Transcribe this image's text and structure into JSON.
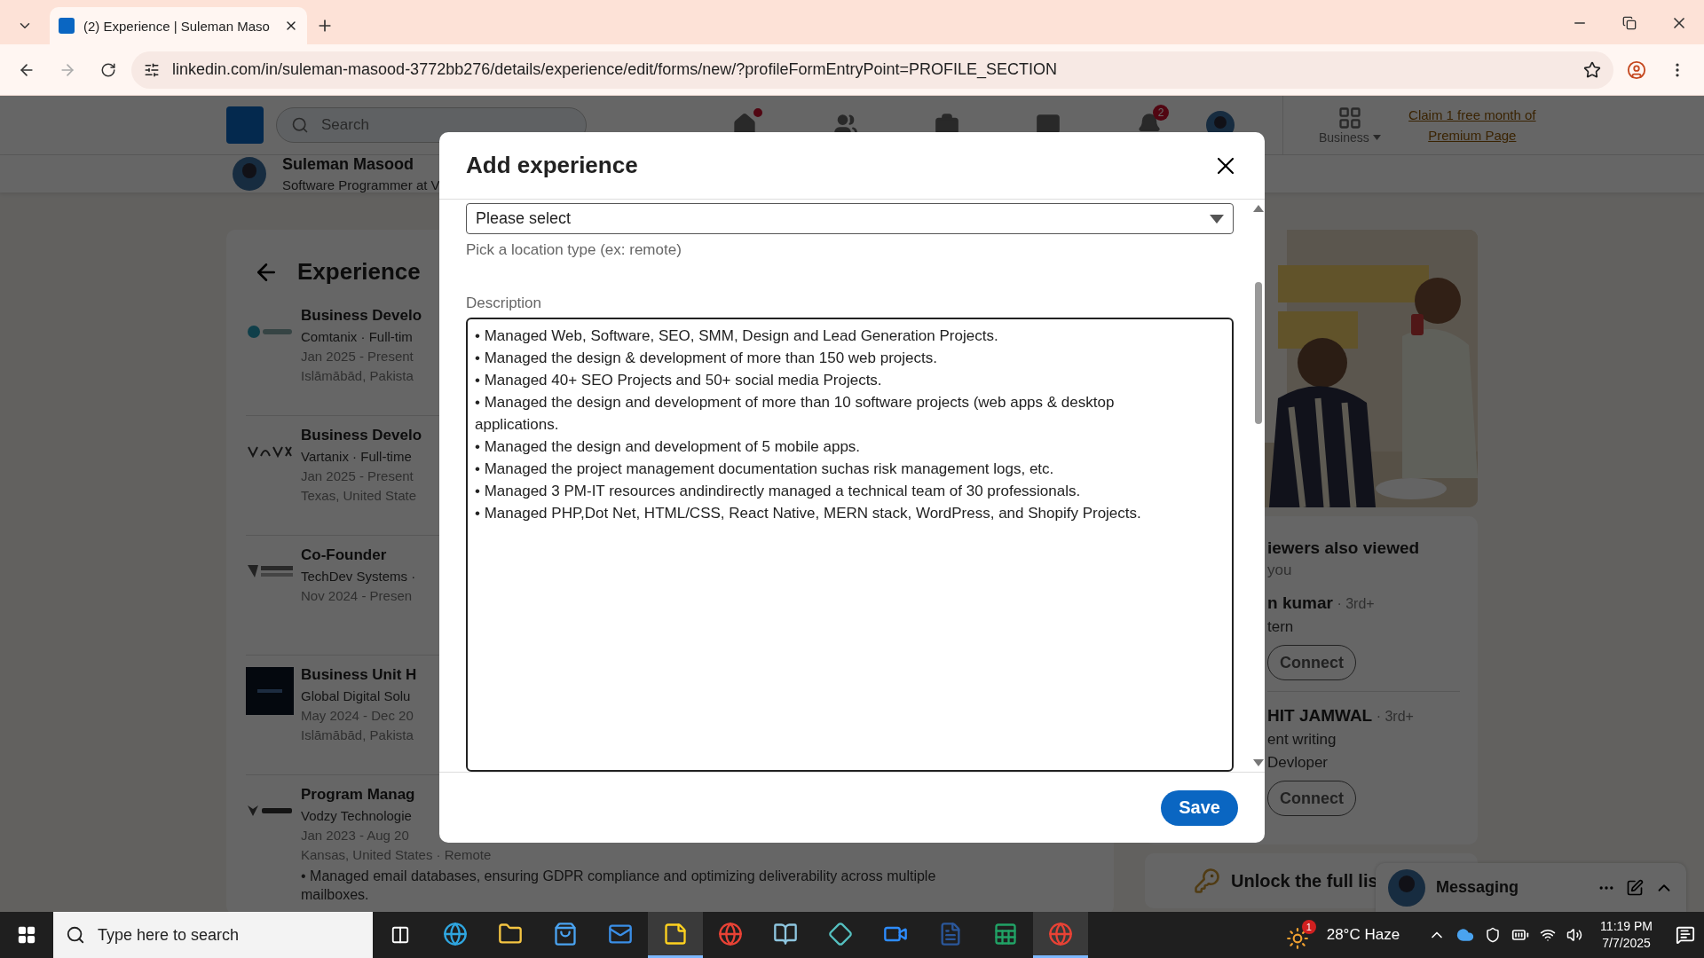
{
  "browser": {
    "tabs": [
      {
        "title": "(2) Experience | Suleman Maso",
        "selected": true
      }
    ],
    "url": "linkedin.com/in/suleman-masood-3772bb276/details/experience/edit/forms/new/?profileFormEntryPoint=PROFILE_SECTION"
  },
  "header": {
    "search_placeholder": "Search",
    "nav": [
      {
        "dot": true
      },
      {
        "dot": false
      },
      {
        "dot": false
      },
      {
        "dot": false
      },
      {
        "badge": "2"
      }
    ],
    "business": "Business",
    "premium": "Claim 1 free month of Premium Page"
  },
  "profile": {
    "name": "Suleman Masood",
    "headline": "Software Programmer at V"
  },
  "experience": {
    "title": "Experience",
    "entries": [
      {
        "kind": "ring",
        "title": "Business Develo",
        "lines": [
          "Comtanix · Full-tim",
          "Jan 2025 - Present",
          "Islāmābād, Pakista"
        ]
      },
      {
        "kind": "wordmark",
        "title": "Business Develo",
        "lines": [
          "Vartanix · Full-time",
          "Jan 2025 - Present",
          "Texas, United State"
        ]
      },
      {
        "kind": "stripes",
        "title": "Co-Founder",
        "lines": [
          "TechDev Systems ·",
          "Nov 2024 - Presen"
        ]
      },
      {
        "kind": "dark",
        "title": "Business Unit H",
        "lines": [
          "Global Digital Solu",
          "May 2024 - Dec 20",
          "Islāmābād, Pakista"
        ]
      },
      {
        "kind": "wing",
        "title": "Program Manag",
        "lines": [
          "Vodzy Technologie",
          "Jan 2023 - Aug 20",
          "Kansas, United States · Remote"
        ]
      }
    ],
    "note": "• Managed email databases, ensuring GDPR compliance and optimizing deliverability across multiple mailboxes."
  },
  "sidebar": {
    "title": "iewers also viewed",
    "subtitle": "you",
    "people": [
      {
        "name": "n kumar",
        "degree": "· 3rd+",
        "lines": [
          "tern"
        ],
        "action": "Connect"
      },
      {
        "name": "HIT JAMWAL",
        "degree": "· 3rd+",
        "lines": [
          "ent writing",
          "Devloper"
        ],
        "action": "Connect"
      }
    ],
    "unlock": "Unlock the full lis"
  },
  "messaging": {
    "title": "Messaging"
  },
  "modal": {
    "title": "Add experience",
    "select": {
      "value": "Please select",
      "hint": "Pick a location type (ex: remote)"
    },
    "description": {
      "label": "Description",
      "lines": [
        "• Managed Web, Software, SEO, SMM, Design and Lead Generation Projects.",
        "• Managed the design & development of more than 150 web projects.",
        "• Managed 40+ SEO Projects and 50+ social media Projects.",
        "• Managed the design and development of more than 10 software projects (web apps & desktop",
        "applications.",
        "• Managed the design and development of 5 mobile apps.",
        "• Managed the project management documentation suchas risk management logs, etc.",
        "• Managed 3 PM-IT resources andindirectly managed a technical team of 30 professionals.",
        "• Managed PHP,Dot Net, HTML/CSS, React Native, MERN stack, WordPress, and Shopify Projects."
      ]
    },
    "save": "Save"
  },
  "taskbar": {
    "search_placeholder": "Type here to search",
    "apps": [
      {
        "selected": false
      },
      {
        "selected": false
      },
      {
        "selected": false
      },
      {
        "selected": false
      },
      {
        "selected": true
      },
      {
        "selected": false
      },
      {
        "selected": false
      },
      {
        "selected": false
      },
      {
        "selected": false
      },
      {
        "selected": false
      },
      {
        "selected": false
      },
      {
        "selected": true
      }
    ],
    "weather": {
      "badge": "1",
      "text": "28°C Haze"
    },
    "time": "11:19 PM",
    "date": "7/7/2025"
  }
}
